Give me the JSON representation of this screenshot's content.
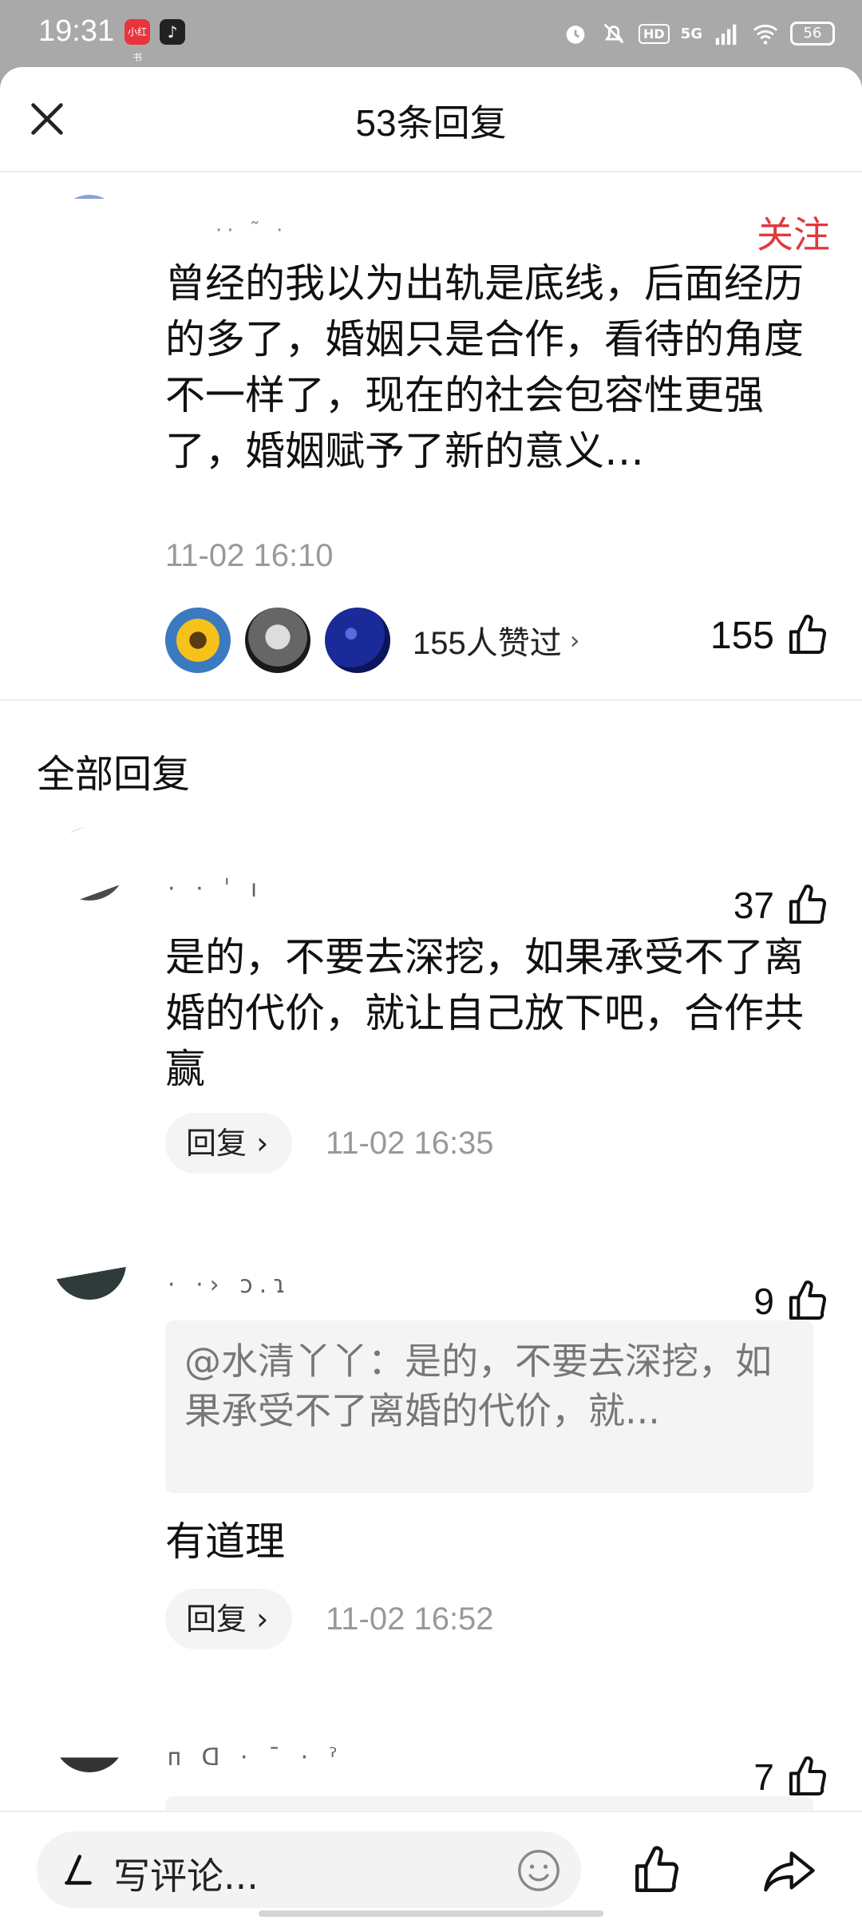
{
  "status_bar": {
    "time": "19:31",
    "app1_label": "小红书",
    "app2_label": "♪",
    "hd_label": "HD",
    "network": "5G",
    "battery": "56"
  },
  "header": {
    "title": "53条回复"
  },
  "main_comment": {
    "follow_label": "关注",
    "text": "曾经的我以为出轨是底线，后面经历的多了，婚姻只是合作，看待的角度不一样了，现在的社会包容性更强了，婚姻赋予了新的意义…",
    "time": "11-02 16:10",
    "likers_label": "155人赞过",
    "like_count": "155"
  },
  "section_title": "全部回复",
  "replies": [
    {
      "like_count": "37",
      "text": "是的，不要去深挖，如果承受不了离婚的代价，就让自己放下吧，合作共赢",
      "reply_label": "回复",
      "time": "11-02 16:35"
    },
    {
      "like_count": "9",
      "quote": "@水清丫丫：是的，不要去深挖，如果承受不了离婚的代价，就...",
      "text": "有道理",
      "reply_label": "回复",
      "time": "11-02 16:52"
    },
    {
      "like_count": "7"
    }
  ],
  "bottom_bar": {
    "placeholder": "写评论..."
  },
  "colors": {
    "accent_red": "#e0393e",
    "muted_gray": "#999999"
  }
}
